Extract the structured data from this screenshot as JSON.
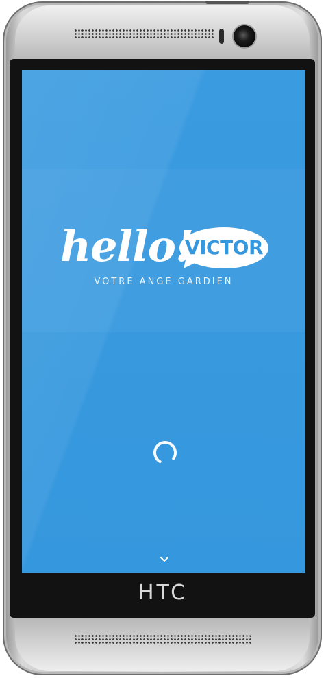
{
  "app": {
    "logo_word": "hello!",
    "logo_name": "VICTOR",
    "tagline": "VOTRE ANGE GARDIEN"
  },
  "device": {
    "brand": "HTC"
  },
  "colors": {
    "screen_background": "#3597dd",
    "logo_text": "#ffffff",
    "bubble": "#ffffff",
    "bubble_text": "#3597dd"
  },
  "icons": {
    "loading": "spinner-icon",
    "scroll_hint": "chevron-down-icon"
  }
}
